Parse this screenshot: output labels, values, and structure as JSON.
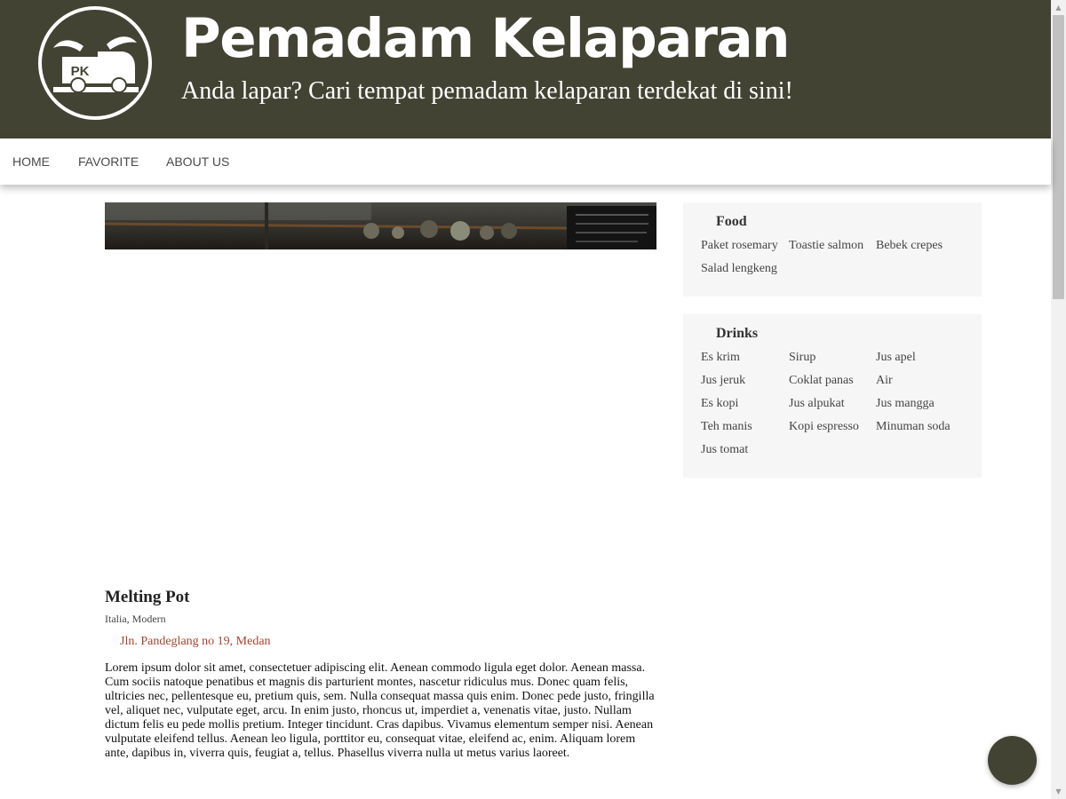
{
  "header": {
    "logo_text": "PK",
    "title": "Pemadam Kelaparan",
    "tagline": "Anda lapar? Cari tempat pemadam kelaparan terdekat di sini!"
  },
  "nav": {
    "items": [
      {
        "label": "HOME"
      },
      {
        "label": "FAVORITE"
      },
      {
        "label": "ABOUT US"
      }
    ]
  },
  "place": {
    "name": "Melting Pot",
    "tags": [
      "Italia",
      "Modern"
    ],
    "address": "Jln. Pandeglang no 19, Medan",
    "description": "Lorem ipsum dolor sit amet, consectetuer adipiscing elit. Aenean commodo ligula eget dolor. Aenean massa. Cum sociis natoque penatibus et magnis dis parturient montes, nascetur ridiculus mus. Donec quam felis, ultricies nec, pellentesque eu, pretium quis, sem. Nulla consequat massa quis enim. Donec pede justo, fringilla vel, aliquet nec, vulputate eget, arcu. In enim justo, rhoncus ut, imperdiet a, venenatis vitae, justo. Nullam dictum felis eu pede mollis pretium. Integer tincidunt. Cras dapibus. Vivamus elementum semper nisi. Aenean vulputate eleifend tellus. Aenean leo ligula, porttitor eu, consequat vitae, eleifend ac, enim. Aliquam lorem ante, dapibus in, viverra quis, feugiat a, tellus. Phasellus viverra nulla ut metus varius laoreet."
  },
  "sidebar": {
    "food": {
      "title": "Food",
      "items": [
        "Paket rosemary",
        "Toastie salmon",
        "Bebek crepes",
        "Salad lengkeng"
      ]
    },
    "drinks": {
      "title": "Drinks",
      "items": [
        "Es krim",
        "Sirup",
        "Jus apel",
        "Jus jeruk",
        "Coklat panas",
        "Air",
        "Es kopi",
        "Jus alpukat",
        "Jus mangga",
        "Teh manis",
        "Kopi espresso",
        "Minuman soda",
        "Jus tomat"
      ]
    }
  },
  "colors": {
    "header_bg": "#434334",
    "accent_address": "#a8432b",
    "panel_bg": "#f6f6f6"
  },
  "icons": {
    "logo": "truck-logo-icon",
    "fab": "floating-action-button"
  }
}
